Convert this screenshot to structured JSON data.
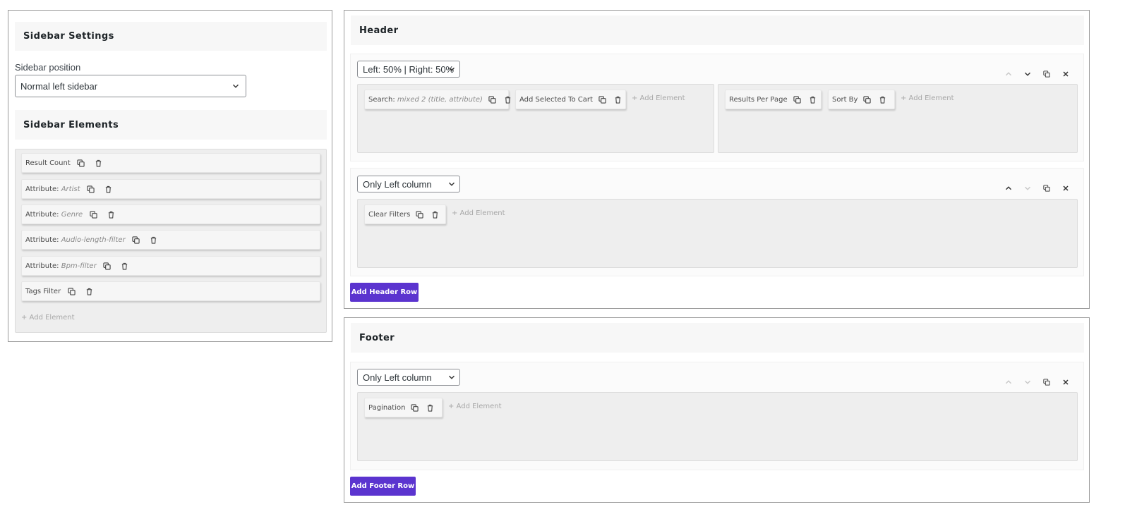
{
  "sidebar": {
    "title": "Sidebar Settings",
    "position_label": "Sidebar position",
    "position_value": "Normal left sidebar",
    "elements_title": "Sidebar Elements",
    "elements": [
      {
        "name": "Result Count",
        "detail": ""
      },
      {
        "name": "Attribute: ",
        "detail": "Artist"
      },
      {
        "name": "Attribute: ",
        "detail": "Genre"
      },
      {
        "name": "Attribute: ",
        "detail": "Audio-length-filter"
      },
      {
        "name": "Attribute: ",
        "detail": "Bpm-filter"
      },
      {
        "name": "Tags Filter",
        "detail": ""
      }
    ],
    "add_element": "+ Add Element"
  },
  "header": {
    "title": "Header",
    "rows": [
      {
        "layout": "Left: 50% | Right: 50%",
        "left_chips": [
          {
            "name": "Search: ",
            "detail": "mixed 2 (title, attribute)"
          },
          {
            "name": "Add Selected To Cart",
            "detail": ""
          }
        ],
        "right_chips": [
          {
            "name": "Results Per Page",
            "detail": ""
          },
          {
            "name": "Sort By",
            "detail": ""
          }
        ]
      },
      {
        "layout": "Only Left column",
        "left_chips": [
          {
            "name": "Clear Filters",
            "detail": ""
          }
        ]
      }
    ],
    "add_element": "+ Add Element",
    "add_row": "Add Header Row"
  },
  "footer": {
    "title": "Footer",
    "rows": [
      {
        "layout": "Only Left column",
        "left_chips": [
          {
            "name": "Pagination",
            "detail": ""
          }
        ]
      }
    ],
    "add_element": "+ Add Element",
    "add_row": "Add Footer Row"
  },
  "colors": {
    "accent": "#5b34cf",
    "zone_bg": "#eeeeee",
    "title_bg": "#f7f7f7"
  },
  "icons": {
    "duplicate": "duplicate-icon",
    "delete": "trash-icon",
    "up": "chevron-up-icon",
    "down": "chevron-down-icon",
    "close": "close-icon"
  }
}
